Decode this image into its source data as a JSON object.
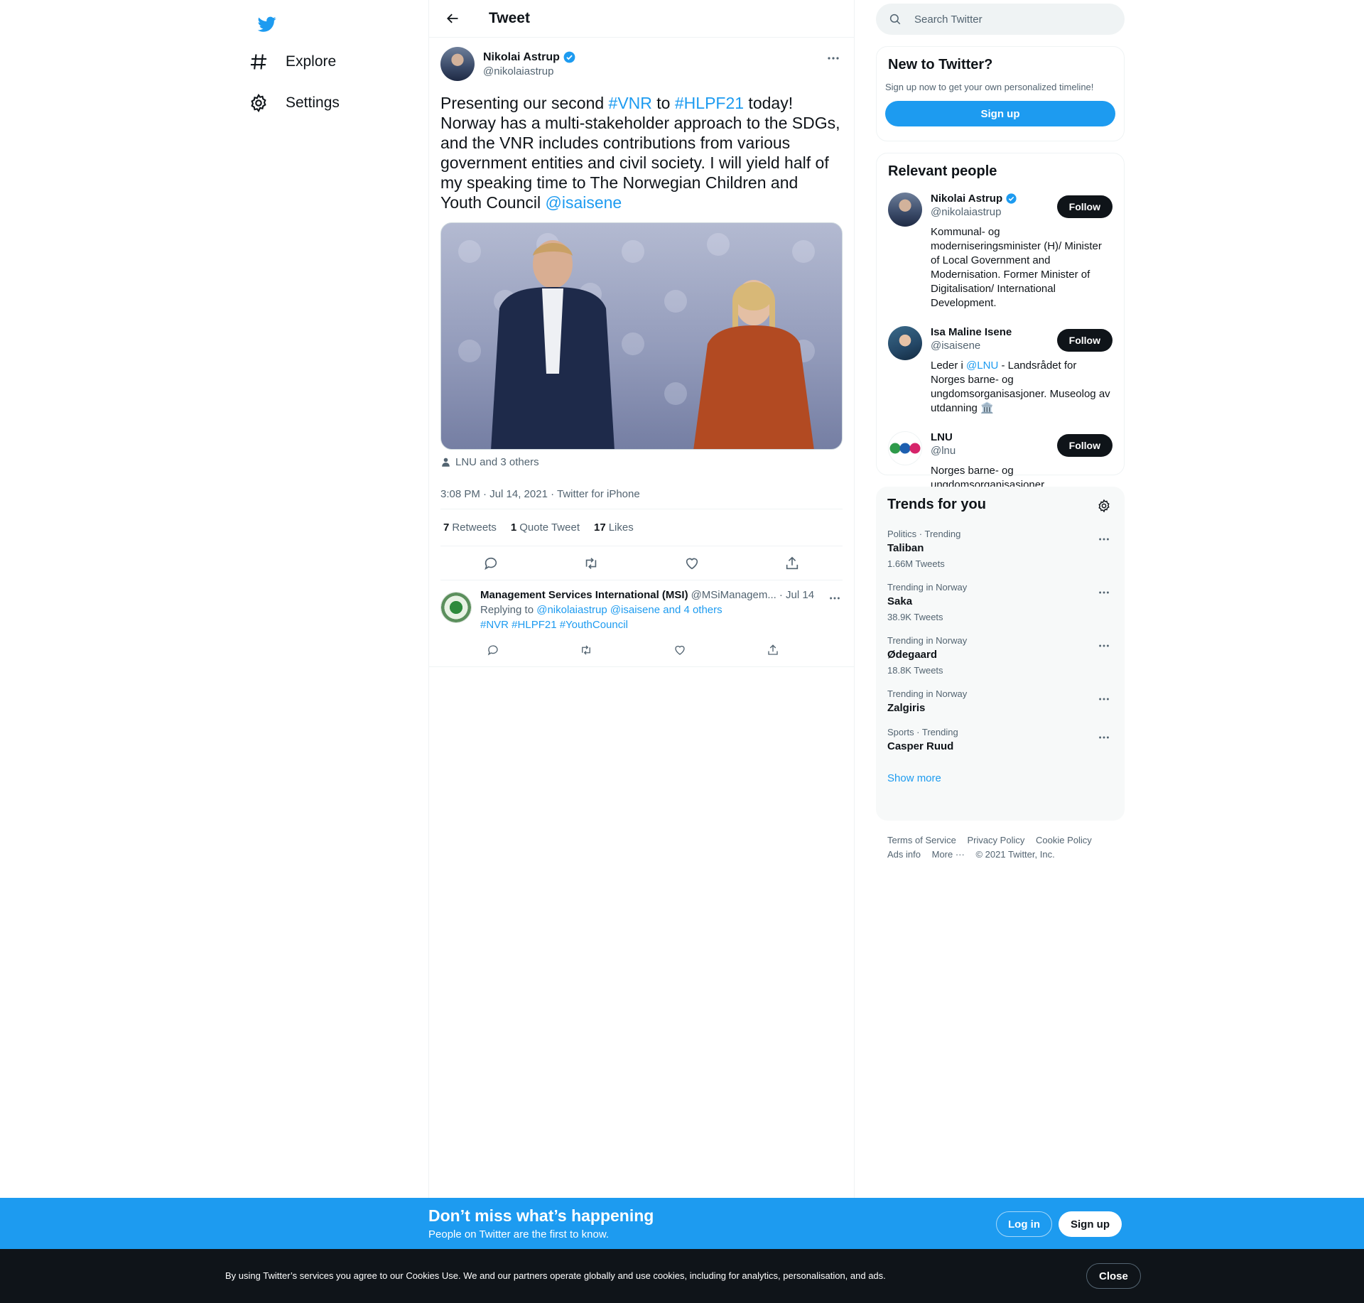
{
  "nav": {
    "explore_label": "Explore",
    "settings_label": "Settings"
  },
  "header": {
    "title": "Tweet"
  },
  "tweet": {
    "author_name": "Nikolai Astrup",
    "author_handle": "@nikolaiastrup",
    "text_part1": "Presenting our second ",
    "hashtag1": "#VNR",
    "text_part2": " to ",
    "hashtag2": "#HLPF21",
    "text_part3": " today! Norway has a multi-stakeholder approach to the SDGs, and the VNR includes contributions from various government entities and civil society. I will yield half of my speaking time to The Norwegian Children and Youth Council ",
    "mention": "@isaisene",
    "tagged": "LNU and 3 others",
    "timestamp": "3:08 PM · Jul 14, 2021 · Twitter for iPhone",
    "retweets_count": "7",
    "retweets_label": "Retweets",
    "quotes_count": "1",
    "quotes_label": "Quote Tweet",
    "likes_count": "17",
    "likes_label": "Likes"
  },
  "reply": {
    "name": "Management Services International (MSI)",
    "handle": "@MSiManagem...",
    "date": "· Jul 14",
    "replying_prefix": "Replying to ",
    "replying_to": "@nikolaiastrup @isaisene and 4 others",
    "hashtags": "#NVR #HLPF21 #YouthCouncil"
  },
  "search": {
    "placeholder": "Search Twitter"
  },
  "new_to_twitter": {
    "title": "New to Twitter?",
    "subtitle": "Sign up now to get your own personalized timeline!",
    "button": "Sign up"
  },
  "relevant_people": {
    "title": "Relevant people",
    "follow_label": "Follow",
    "people": [
      {
        "name": "Nikolai Astrup",
        "handle": "@nikolaiastrup",
        "bio": "Kommunal- og moderniseringsminister (H)/ Minister of Local Government and Modernisation. Former Minister of Digitalisation/ International Development."
      },
      {
        "name": "Isa Maline Isene",
        "handle": "@isaisene",
        "bio_prefix": "Leder i ",
        "bio_mention": "@LNU",
        "bio_suffix": " - Landsrådet for Norges barne- og ungdomsorganisasjoner. Museolog av utdanning 🏛️"
      },
      {
        "name": "LNU",
        "handle": "@lnu",
        "bio": "Norges barne- og ungdomsorganisasjoner"
      }
    ]
  },
  "trends": {
    "title": "Trends for you",
    "items": [
      {
        "meta": "Politics · Trending",
        "name": "Taliban",
        "count": "1.66M Tweets"
      },
      {
        "meta": "Trending in Norway",
        "name": "Saka",
        "count": "38.9K Tweets"
      },
      {
        "meta": "Trending in Norway",
        "name": "Ødegaard",
        "count": "18.8K Tweets"
      },
      {
        "meta": "Trending in Norway",
        "name": "Zalgiris",
        "count": ""
      },
      {
        "meta": "Sports · Trending",
        "name": "Casper Ruud",
        "count": ""
      }
    ],
    "show_more": "Show more"
  },
  "footer": {
    "terms": "Terms of Service",
    "privacy": "Privacy Policy",
    "cookie": "Cookie Policy",
    "ads": "Ads info",
    "more": "More ···",
    "copyright": "© 2021 Twitter, Inc."
  },
  "banner": {
    "title": "Don’t miss what’s happening",
    "subtitle": "People on Twitter are the first to know.",
    "login": "Log in",
    "signup": "Sign up"
  },
  "cookies": {
    "text": "By using Twitter’s services you agree to our Cookies Use. We and our partners operate globally and use cookies, including for analytics, personalisation, and ads.",
    "close": "Close"
  },
  "colors": {
    "accent": "#1d9bf0",
    "text": "#0f1419",
    "secondary": "#536471",
    "border": "#eff3f4"
  }
}
